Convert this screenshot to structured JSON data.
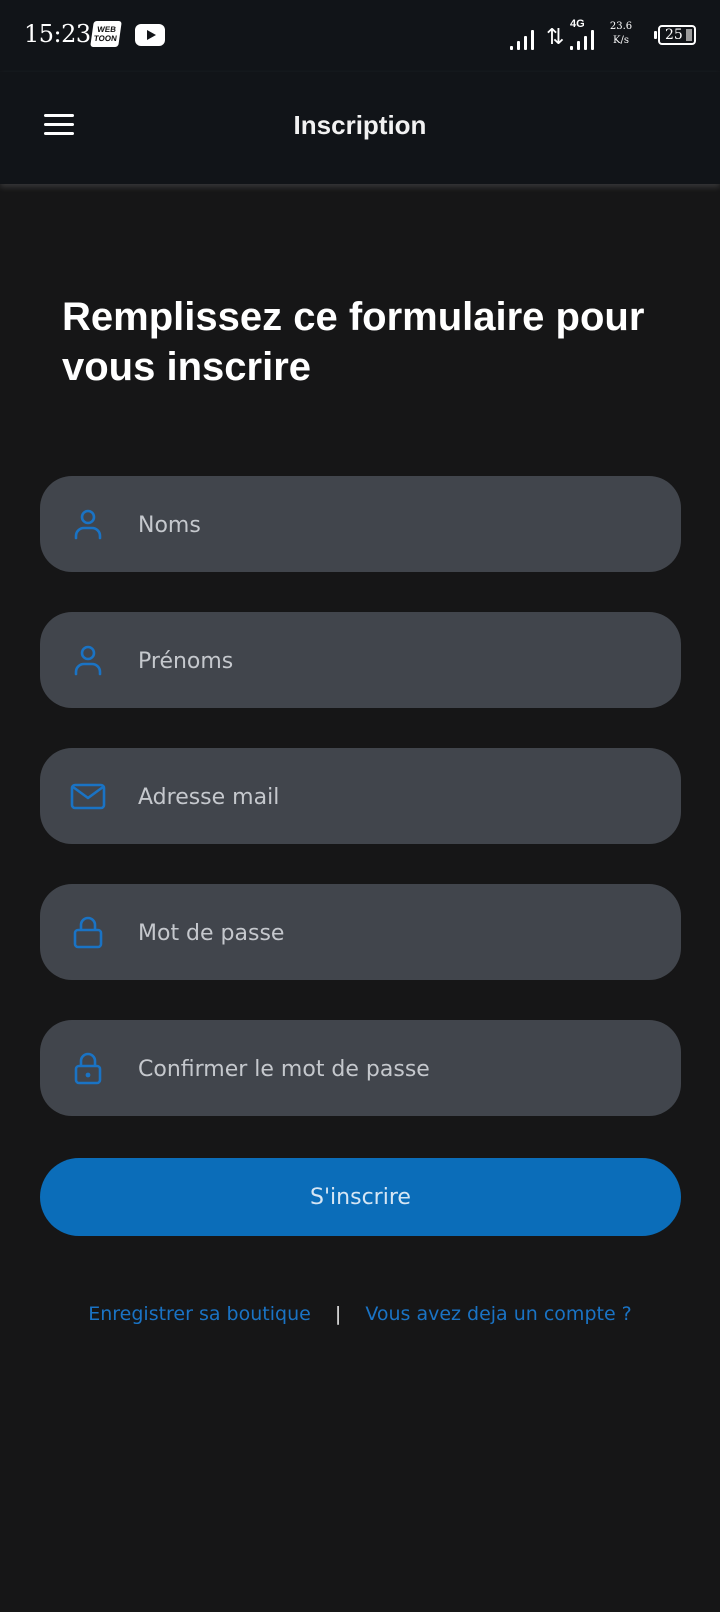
{
  "status_bar": {
    "time": "15:23",
    "app_badge_text": "WEB TOON",
    "network_label": "4G",
    "speed_value": "23.6",
    "speed_unit": "K/s",
    "battery_level": "25"
  },
  "header": {
    "title": "Inscription"
  },
  "main": {
    "headline": "Remplissez ce formulaire pour vous inscrire",
    "fields": [
      {
        "placeholder": "Noms",
        "value": "",
        "icon": "person-icon"
      },
      {
        "placeholder": "Prénoms",
        "value": "",
        "icon": "person-icon"
      },
      {
        "placeholder": "Adresse mail",
        "value": "",
        "icon": "mail-icon"
      },
      {
        "placeholder": "Mot de passe",
        "value": "",
        "icon": "lock-icon"
      },
      {
        "placeholder": "Confirmer le mot de passe",
        "value": "",
        "icon": "lock-icon"
      }
    ],
    "submit_label": "S'inscrire",
    "links": {
      "register_shop": "Enregistrer sa boutique",
      "separator": "|",
      "have_account": "Vous avez deja un compte ?"
    }
  },
  "colors": {
    "background": "#161617",
    "bar_background": "#111418",
    "field_background": "#41454c",
    "accent": "#0b6db9",
    "link": "#1a73c4"
  }
}
